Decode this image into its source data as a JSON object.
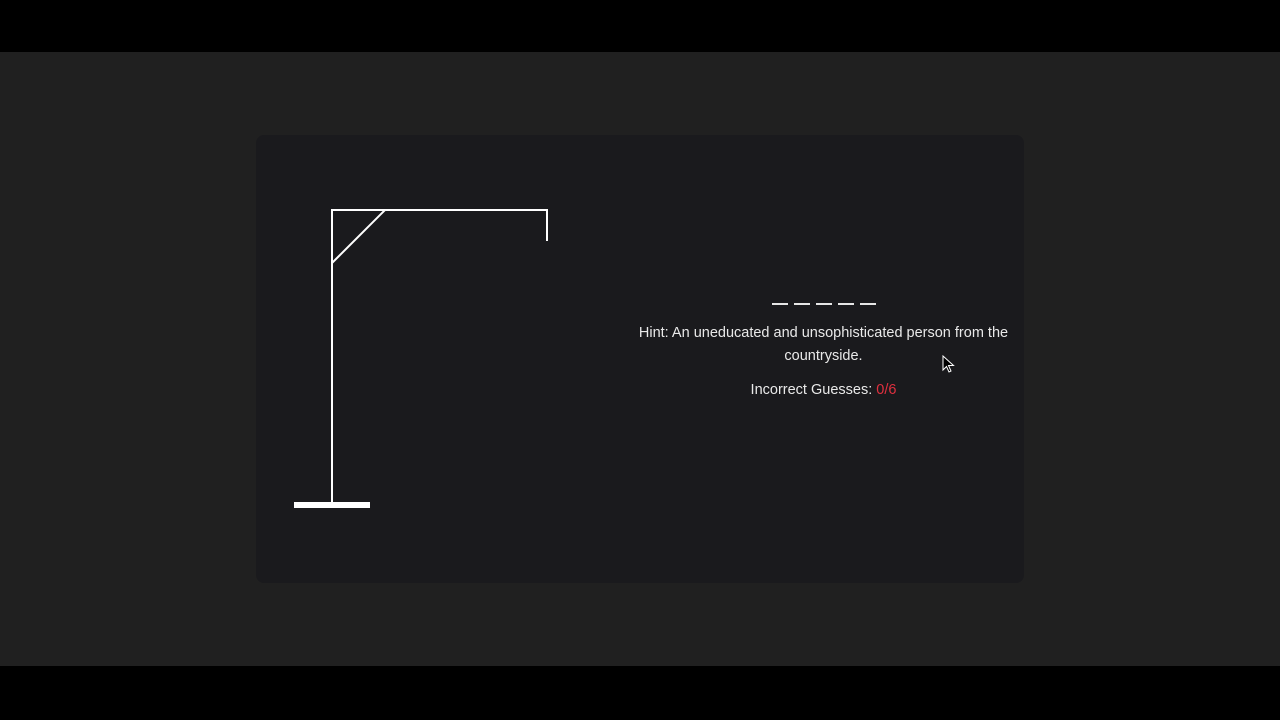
{
  "game": {
    "word_slots": [
      "",
      "",
      "",
      "",
      ""
    ],
    "hint_text": "Hint: An uneducated and unsophisticated person from the countryside.",
    "incorrect_label": "Incorrect Guesses: ",
    "incorrect_count": "0/6",
    "max_incorrect": 6,
    "incorrect_value": 0
  },
  "colors": {
    "page_bg": "#202020",
    "card_bg": "#1a1a1d",
    "gallows": "#ffffff",
    "text": "#e9e9e9",
    "accent": "#e0303f"
  }
}
